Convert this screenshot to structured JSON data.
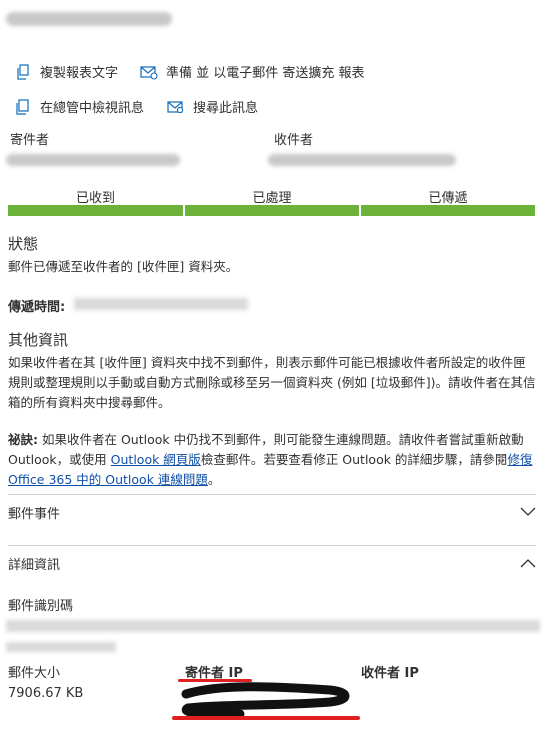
{
  "actions": {
    "copy_report": "複製報表文字",
    "prepare_email": "準備 並 以電子郵件 寄送擴充 報表",
    "view_in_admin": "在總管中檢視訊息",
    "search_message": "搜尋此訊息"
  },
  "sender_label": "寄件者",
  "recipient_label": "收件者",
  "stages": [
    "已收到",
    "已處理",
    "已傳遞"
  ],
  "stage_color": "#6bb13a",
  "status": {
    "heading": "狀態",
    "text": "郵件已傳遞至收件者的 [收件匣] 資料夾。"
  },
  "delivery_time_label": "傳遞時間:",
  "more_info": {
    "heading": "其他資訊",
    "text": "如果收件者在其 [收件匣] 資料夾中找不到郵件，則表示郵件可能已根據收件者所設定的收件匣規則或整理規則以手動或自動方式刪除或移至另一個資料夾 (例如 [垃圾郵件])。請收件者在其信箱的所有資料夾中搜尋郵件。"
  },
  "tip": {
    "label": "祕訣:",
    "text1": " 如果收件者在 Outlook 中仍找不到郵件，則可能發生連線問題。請收件者嘗試重新啟動 Outlook，或使用 ",
    "link1": "Outlook 網頁版",
    "text2": "檢查郵件。若要查看修正 Outlook 的詳細步驟，請參閱",
    "link2": "修復 Office 365 中的 Outlook 連線問題",
    "text3": "。"
  },
  "sections": {
    "events": "郵件事件",
    "details": "詳細資訊"
  },
  "details": {
    "message_id_label": "郵件識別碼",
    "size_label": "郵件大小",
    "size_value": "7906.67 KB",
    "sender_ip_label": "寄件者 IP",
    "recipient_ip_label": "收件者 IP"
  },
  "icons": [
    "copy-icon",
    "mail-icon",
    "document-icon",
    "search-mail-icon",
    "chevron-down-icon",
    "chevron-up-icon"
  ],
  "colors": {
    "accent": "#0f6cbd",
    "link": "#0f4fa8",
    "redaction": "#e02020"
  }
}
